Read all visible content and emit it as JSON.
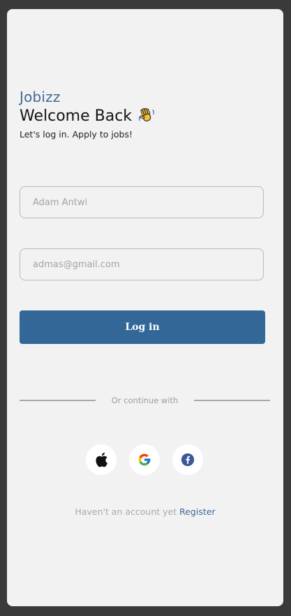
{
  "header": {
    "brand": "Jobizz",
    "title": "Welcome Back",
    "subtitle": "Let's log in. Apply to jobs!"
  },
  "form": {
    "name_placeholder": "Adam Antwi",
    "email_placeholder": "admas@gmail.com",
    "login_label": "Log in"
  },
  "divider": {
    "text": "Or continue with"
  },
  "social": [
    "apple-icon",
    "google-icon",
    "facebook-icon"
  ],
  "register": {
    "prompt": "Haven't an account yet",
    "link": "Register"
  },
  "colors": {
    "brand": "#3d6a97",
    "button": "#326797",
    "background": "#f2f2f2",
    "frame": "#3a3a3a"
  }
}
